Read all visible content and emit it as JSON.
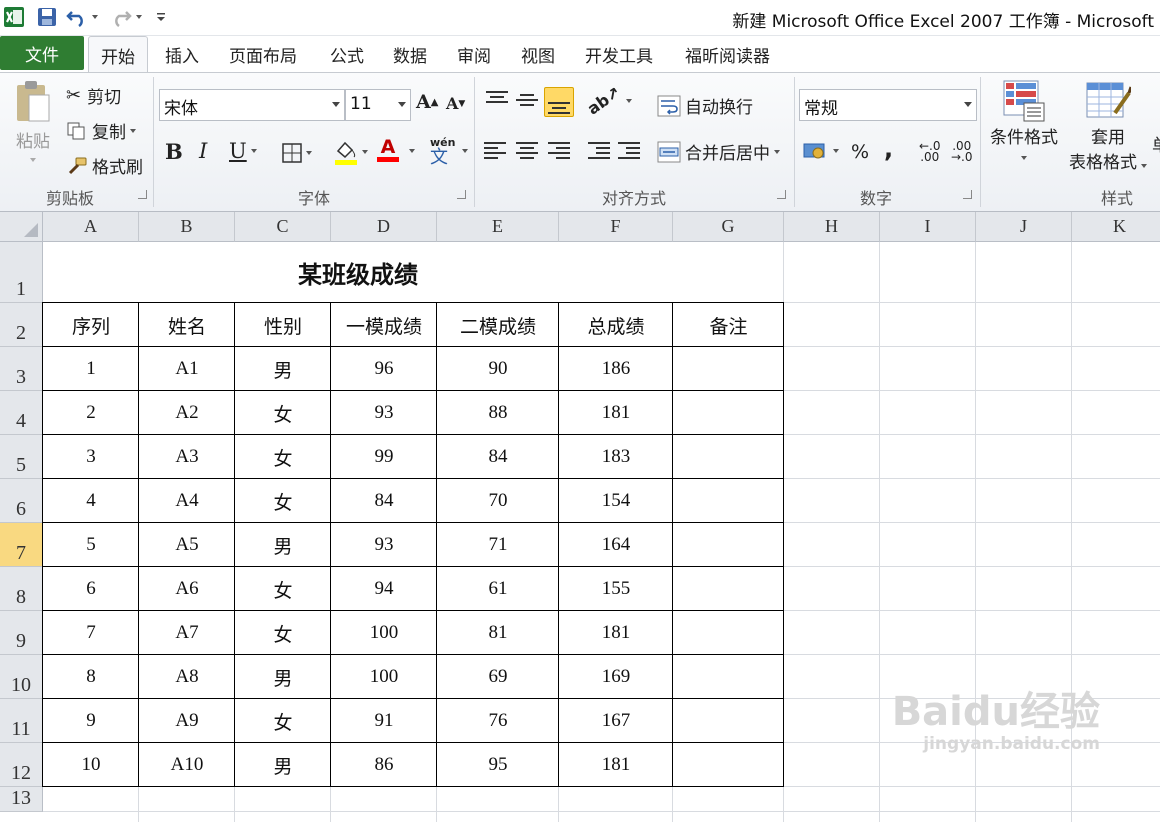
{
  "window": {
    "title": "新建 Microsoft Office Excel 2007 工作簿 - Microsoft"
  },
  "ribbon": {
    "file_tab": "文件",
    "tabs": [
      "开始",
      "插入",
      "页面布局",
      "公式",
      "数据",
      "审阅",
      "视图",
      "开发工具",
      "福昕阅读器"
    ],
    "clipboard": {
      "paste": "粘贴",
      "cut": "剪切",
      "copy": "复制",
      "format_painter": "格式刷",
      "label": "剪贴板"
    },
    "font": {
      "name": "宋体",
      "size": "11",
      "bold": "B",
      "italic": "I",
      "underline": "U",
      "label": "字体",
      "font_color": "A",
      "phonetic": "wén"
    },
    "alignment": {
      "wrap": "自动换行",
      "merge": "合并后居中",
      "label": "对齐方式"
    },
    "number": {
      "format": "常规",
      "percent": "%",
      "comma": ",",
      "inc_decimal": ".00",
      "dec_decimal": ".00",
      "label": "数字"
    },
    "styles": {
      "conditional": "条件格式",
      "table_line1": "套用",
      "table_line2": "表格格式",
      "label": "样式"
    }
  },
  "sheet": {
    "columns": [
      "A",
      "B",
      "C",
      "D",
      "E",
      "F",
      "G",
      "H",
      "I",
      "J",
      "K"
    ],
    "rows": [
      "1",
      "2",
      "3",
      "4",
      "5",
      "6",
      "7",
      "8",
      "9",
      "10",
      "11",
      "12",
      "13"
    ],
    "selected_row": "7",
    "title": "某班级成绩",
    "headers": [
      "序列",
      "姓名",
      "性别",
      "一模成绩",
      "二模成绩",
      "总成绩",
      "备注"
    ],
    "records": [
      [
        "1",
        "A1",
        "男",
        "96",
        "90",
        "186",
        ""
      ],
      [
        "2",
        "A2",
        "女",
        "93",
        "88",
        "181",
        ""
      ],
      [
        "3",
        "A3",
        "女",
        "99",
        "84",
        "183",
        ""
      ],
      [
        "4",
        "A4",
        "女",
        "84",
        "70",
        "154",
        ""
      ],
      [
        "5",
        "A5",
        "男",
        "93",
        "71",
        "164",
        ""
      ],
      [
        "6",
        "A6",
        "女",
        "94",
        "61",
        "155",
        ""
      ],
      [
        "7",
        "A7",
        "女",
        "100",
        "81",
        "181",
        ""
      ],
      [
        "8",
        "A8",
        "男",
        "100",
        "69",
        "169",
        ""
      ],
      [
        "9",
        "A9",
        "女",
        "91",
        "76",
        "167",
        ""
      ],
      [
        "10",
        "A10",
        "男",
        "86",
        "95",
        "181",
        ""
      ]
    ]
  },
  "watermark": {
    "logo": "Baidu经验",
    "url": "jingyan.baidu.com"
  },
  "colors": {
    "file_tab": "#2f7d32",
    "selected_row_header": "#f9d981",
    "highlight": "#ffd966"
  }
}
